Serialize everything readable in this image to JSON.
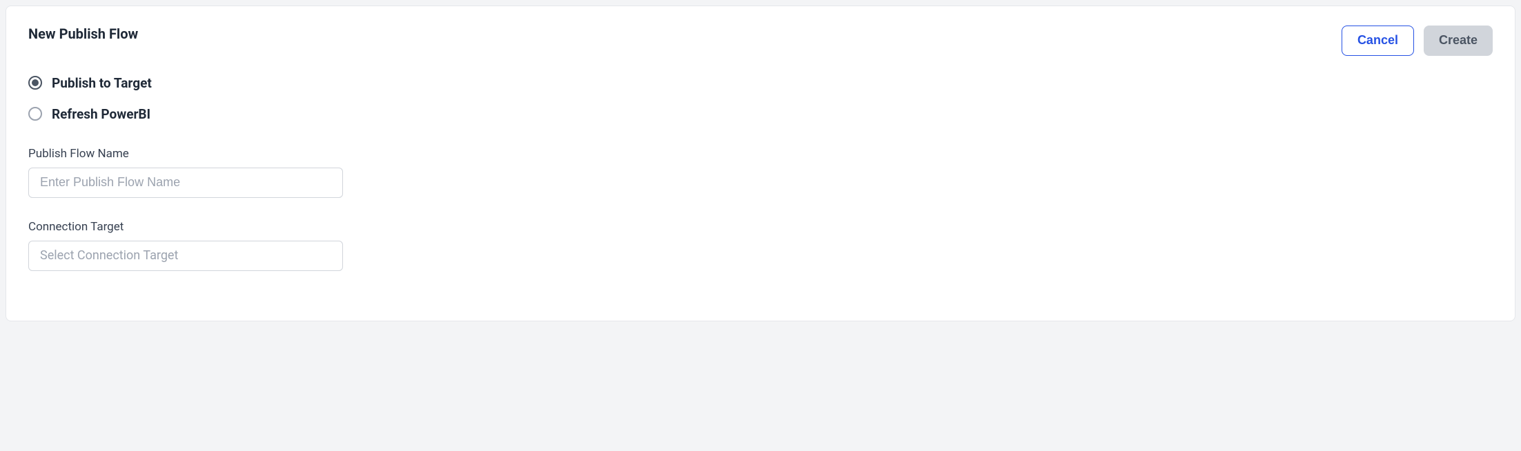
{
  "header": {
    "title": "New Publish Flow",
    "cancel_label": "Cancel",
    "create_label": "Create"
  },
  "radio": {
    "options": [
      {
        "label": "Publish to Target",
        "selected": true
      },
      {
        "label": "Refresh PowerBI",
        "selected": false
      }
    ]
  },
  "form": {
    "flow_name": {
      "label": "Publish Flow Name",
      "placeholder": "Enter Publish Flow Name",
      "value": ""
    },
    "connection_target": {
      "label": "Connection Target",
      "placeholder": "Select Connection Target",
      "value": ""
    }
  }
}
